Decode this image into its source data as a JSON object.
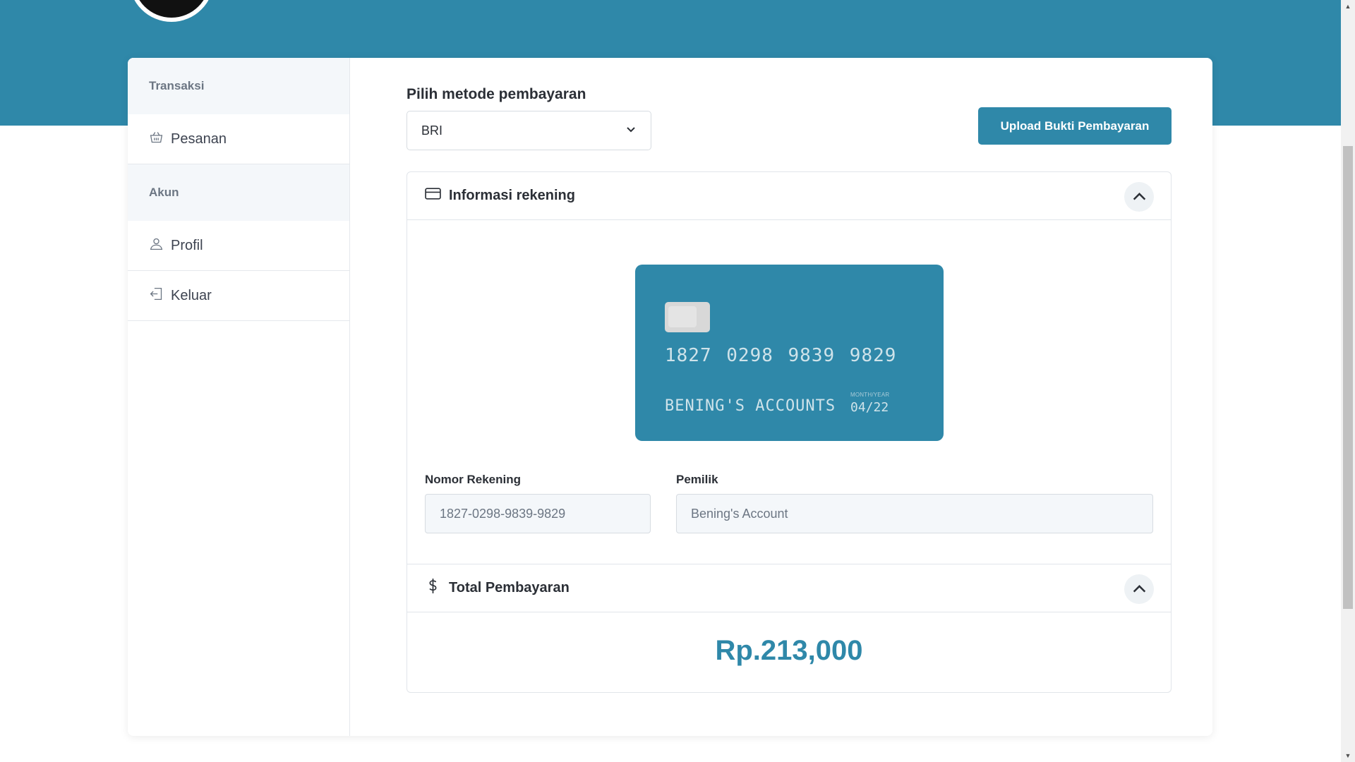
{
  "colors": {
    "accent": "#2f88a9",
    "sidebar_head_bg": "#f4f7fa"
  },
  "sidebar": {
    "section_transaksi": "Transaksi",
    "item_pesanan": {
      "label": "Pesanan",
      "icon": "basket-icon"
    },
    "section_akun": "Akun",
    "item_profil": {
      "label": "Profil",
      "icon": "user-icon"
    },
    "item_keluar": {
      "label": "Keluar",
      "icon": "logout-icon"
    }
  },
  "payment": {
    "method_label": "Pilih metode pembayaran",
    "method_selected": "BRI",
    "upload_button": "Upload Bukti Pembayaran"
  },
  "account_info": {
    "title": "Informasi rekening",
    "icon": "credit-card-icon",
    "card": {
      "number": "1827 0298 9839 9829",
      "holder": "BENING'S ACCOUNTS",
      "expiry_label": "MONTH/YEAR",
      "expiry": "04/22"
    },
    "account_number_label": "Nomor Rekening",
    "account_number_value": "1827-0298-9839-9829",
    "owner_label": "Pemilik",
    "owner_value": "Bening's Account"
  },
  "total": {
    "title": "Total Pembayaran",
    "icon": "dollar-icon",
    "amount": "Rp.213,000"
  }
}
